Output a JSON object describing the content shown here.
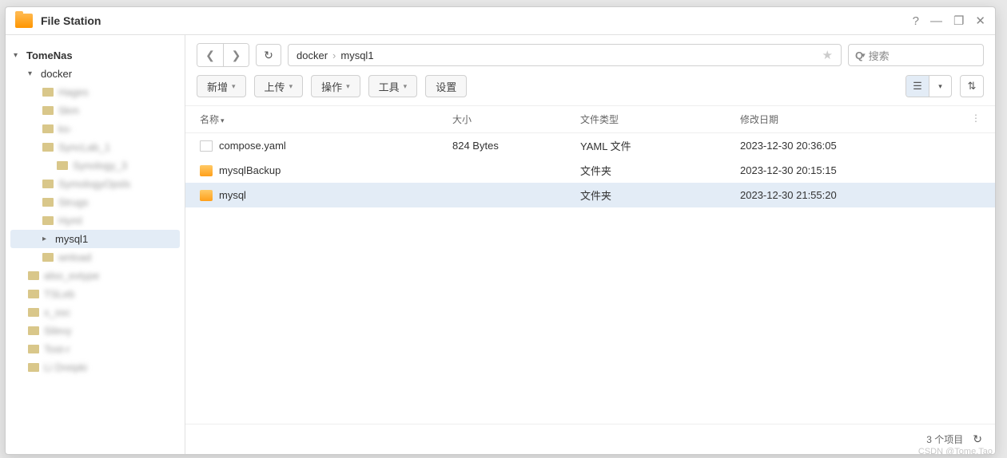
{
  "title": "File Station",
  "breadcrumb": [
    "docker",
    "mysql1"
  ],
  "search_placeholder": "搜索",
  "toolbar": {
    "new": "新增",
    "upload": "上传",
    "action": "操作",
    "tool": "工具",
    "settings": "设置"
  },
  "columns": {
    "name": "名称",
    "size": "大小",
    "type": "文件类型",
    "date": "修改日期"
  },
  "tree": {
    "root": "TomeNas",
    "docker": "docker",
    "selected": "mysql1",
    "blurred": [
      "Hages",
      "Skm",
      "ks-",
      "SyncLab_1",
      "Synology_3",
      "SymologyOpsls",
      "Strugs",
      "Hyml",
      "",
      "wnload",
      "also_extype",
      "TSLeb",
      "x_ssc",
      "Silevy",
      "Tost-r",
      "Li Dreipki"
    ]
  },
  "files": [
    {
      "name": "compose.yaml",
      "size": "824 Bytes",
      "type": "YAML 文件",
      "date": "2023-12-30 20:36:05",
      "kind": "file"
    },
    {
      "name": "mysqlBackup",
      "size": "",
      "type": "文件夹",
      "date": "2023-12-30 20:15:15",
      "kind": "folder"
    },
    {
      "name": "mysql",
      "size": "",
      "type": "文件夹",
      "date": "2023-12-30 21:55:20",
      "kind": "folder",
      "selected": true
    }
  ],
  "footer": "3 个项目",
  "watermark": "CSDN @Tome.Tao"
}
